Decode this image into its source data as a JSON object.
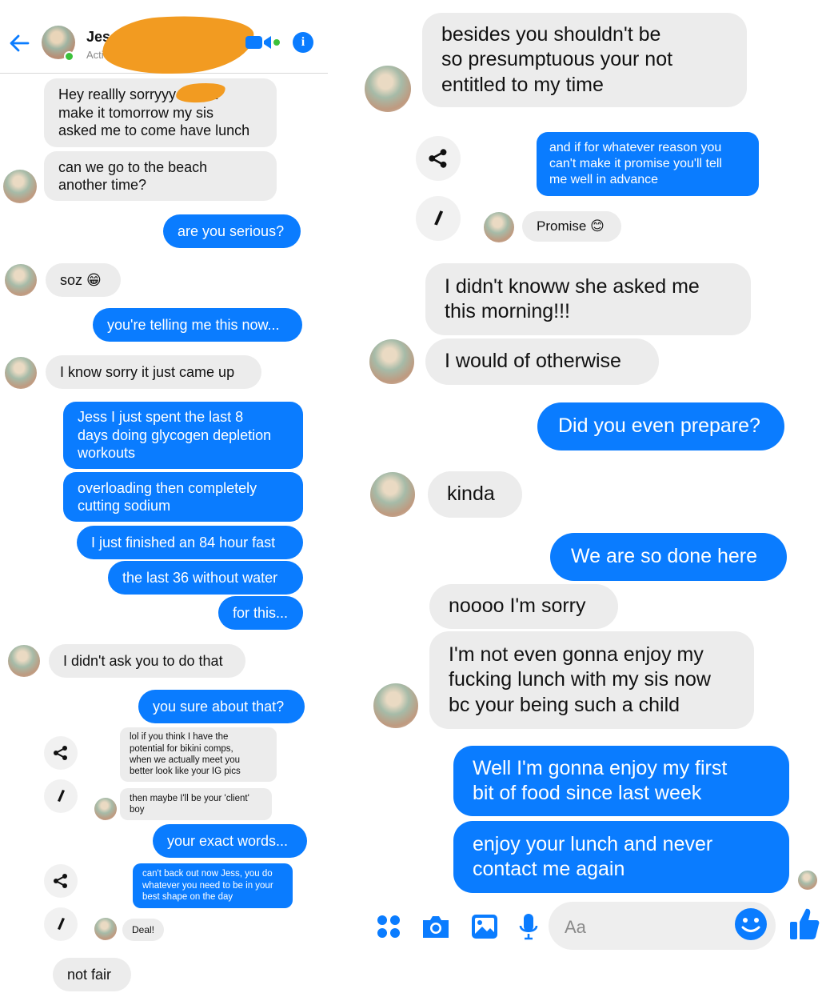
{
  "colors": {
    "accent": "#0a7cff",
    "incoming_bubble": "#ececec",
    "redaction": "#f29b21",
    "online": "#3cc13b"
  },
  "header": {
    "contact_name": "Jes",
    "active_status": "Acti",
    "back_icon": "back-arrow-icon",
    "video_icon": "video-call-icon",
    "info_icon": "info-icon",
    "info_glyph": "i"
  },
  "left_conversation": [
    {
      "from": "them",
      "text": "Hey reallly sorryyy       I can't\nmake it tomorrow my sis\nasked me to come have lunch"
    },
    {
      "from": "them",
      "text": "can we go to the beach\nanother time?"
    },
    {
      "from": "me",
      "text": "are you serious?"
    },
    {
      "from": "them",
      "text": "soz 😁"
    },
    {
      "from": "me",
      "text": "you're telling me this now..."
    },
    {
      "from": "them",
      "text": "I know sorry it just came up"
    },
    {
      "from": "me",
      "text": "Jess I just spent the last 8\ndays doing glycogen depletion\nworkouts"
    },
    {
      "from": "me",
      "text": "overloading then completely\ncutting sodium"
    },
    {
      "from": "me",
      "text": "I just finished an 84 hour fast"
    },
    {
      "from": "me",
      "text": "the last 36 without water"
    },
    {
      "from": "me",
      "text": "for this..."
    },
    {
      "from": "them",
      "text": "I didn't ask you to do that"
    },
    {
      "from": "me",
      "text": "you sure about that?"
    },
    {
      "from": "them",
      "text": "lol if you think I have the\npotential for bikini comps,\nwhen we actually meet you\nbetter look like your IG pics"
    },
    {
      "from": "them",
      "text": "then maybe I'll be your 'client'\nboy"
    },
    {
      "from": "me",
      "text": "your exact words..."
    },
    {
      "from": "me",
      "text": "can't back out now Jess, you do\nwhatever you need to be in your\nbest shape on the day"
    },
    {
      "from": "them",
      "text": "Deal!"
    },
    {
      "from": "them",
      "text": "not fair"
    }
  ],
  "right_conversation": [
    {
      "from": "them",
      "text": "besides you shouldn't be\nso presumptuous your not\nentitled to my time"
    },
    {
      "from": "me",
      "text": "and if for whatever reason you\ncan't make it promise you'll tell\nme well in advance"
    },
    {
      "from": "them",
      "text": "Promise 😊"
    },
    {
      "from": "them",
      "text": "I didn't knoww she asked me\nthis morning!!!"
    },
    {
      "from": "them",
      "text": "I would of otherwise"
    },
    {
      "from": "me",
      "text": "Did you even prepare?"
    },
    {
      "from": "them",
      "text": "kinda"
    },
    {
      "from": "me",
      "text": "We are so done here"
    },
    {
      "from": "them",
      "text": "noooo I'm sorry"
    },
    {
      "from": "them",
      "text": "I'm not even gonna enjoy my\nfucking lunch with my sis now\nbc your being such a child"
    },
    {
      "from": "me",
      "text": "Well I'm gonna enjoy my first\nbit of food since last week"
    },
    {
      "from": "me",
      "text": "enjoy your lunch and never\ncontact me again"
    }
  ],
  "message_actions": {
    "share_icon": "share-icon",
    "edit_icon": "pencil-icon"
  },
  "composer": {
    "placeholder": "Aa",
    "icons": [
      "apps-icon",
      "camera-icon",
      "gallery-icon",
      "microphone-icon",
      "emoji-icon",
      "like-thumb-icon"
    ]
  }
}
